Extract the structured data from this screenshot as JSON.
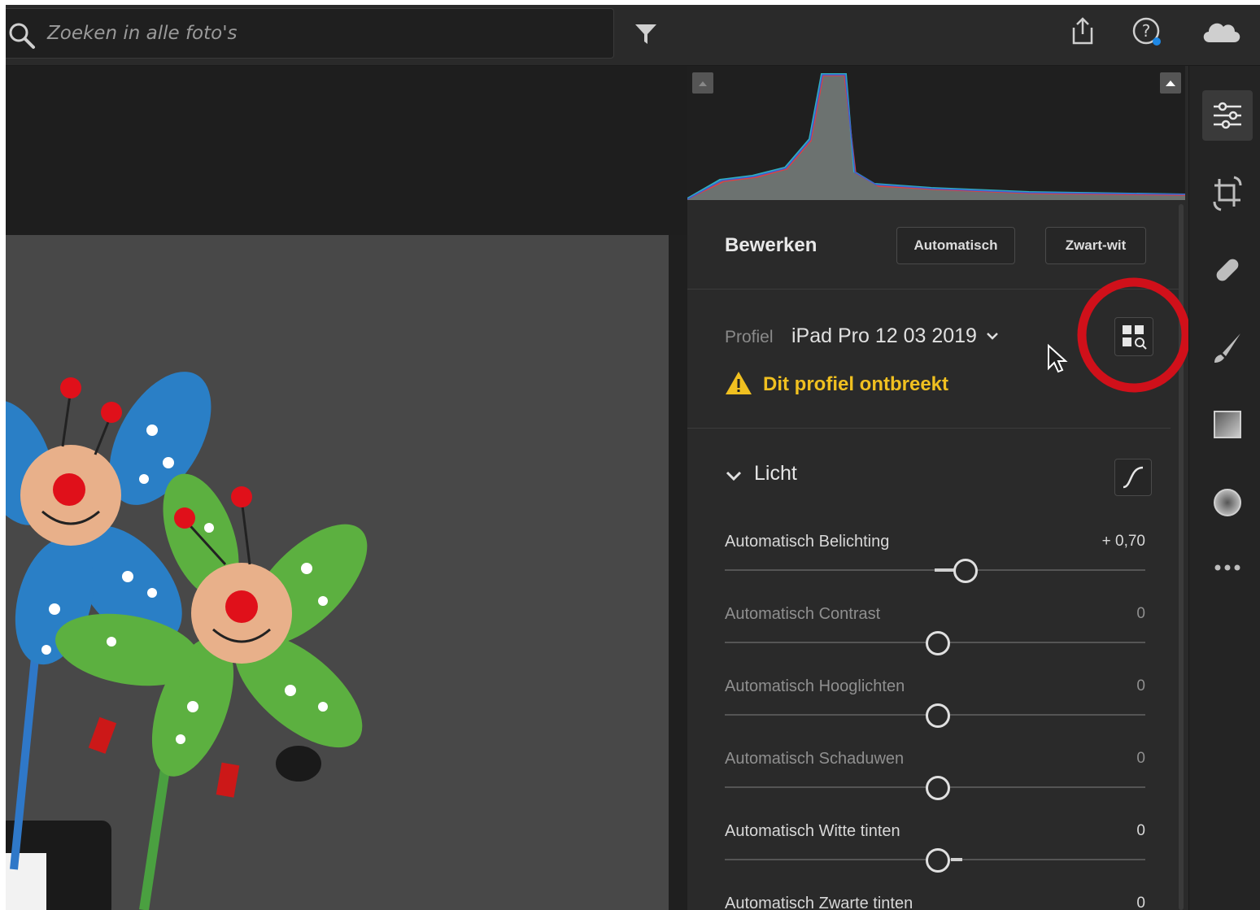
{
  "search": {
    "placeholder": "Zoeken in alle foto's"
  },
  "topbar_icons": [
    "search-icon",
    "filter-icon",
    "share-icon",
    "help-icon",
    "cloud-icon"
  ],
  "panel": {
    "title": "Bewerken",
    "auto_button": "Automatisch",
    "bw_button": "Zwart-wit",
    "profile": {
      "label": "Profiel",
      "value": "iPad Pro 12 03 2019",
      "warning": "Dit profiel ontbreekt"
    },
    "light": {
      "section_label": "Licht",
      "sliders": [
        {
          "name": "Automatisch Belichting",
          "value": "+ 0,70",
          "position": 0.57
        },
        {
          "name": "Automatisch Contrast",
          "value": "0",
          "position": 0.5
        },
        {
          "name": "Automatisch Hooglichten",
          "value": "0",
          "position": 0.5
        },
        {
          "name": "Automatisch Schaduwen",
          "value": "0",
          "position": 0.5
        },
        {
          "name": "Automatisch Witte tinten",
          "value": "0",
          "position": 0.5
        },
        {
          "name": "Automatisch Zwarte tinten",
          "value": "0",
          "position": 0.5
        }
      ]
    }
  },
  "rail_tools": [
    "edit-sliders-icon",
    "crop-icon",
    "healing-icon",
    "brush-icon",
    "linear-gradient-icon",
    "radial-gradient-icon",
    "more-icon"
  ],
  "colors": {
    "warning": "#f0c020",
    "highlight_circle": "#d0101a",
    "panel_bg": "#2a2a2a"
  }
}
